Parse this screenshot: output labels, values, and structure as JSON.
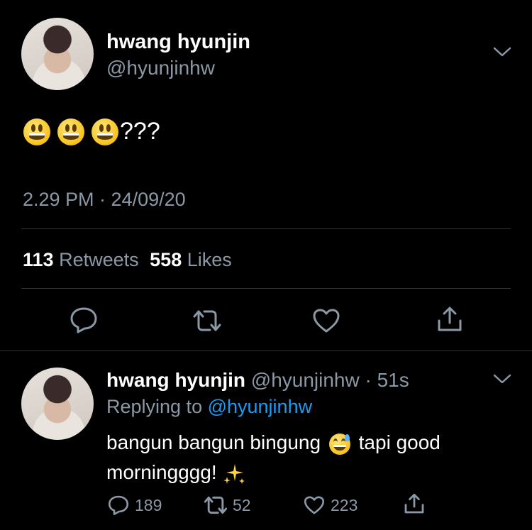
{
  "tweet": {
    "display_name": "hwang hyunjin",
    "handle": "@hyunjinhw",
    "emoji_count": 3,
    "text_suffix": "???",
    "timestamp": "2.29 PM · 24/09/20",
    "retweets_count": "113",
    "retweets_label": "Retweets",
    "likes_count": "558",
    "likes_label": "Likes"
  },
  "reply": {
    "display_name": "hwang hyunjin",
    "handle_time": "@hyunjinhw · 51s",
    "replying_prefix": "Replying to ",
    "replying_handle": "@hyunjinhw",
    "line1_a": "bangun bangun bingung ",
    "line1_b": " tapi good",
    "line2": "morningggg! ",
    "reply_count": "189",
    "retweet_count": "52",
    "like_count": "223"
  },
  "icons": {
    "menu": "chevron-down-icon",
    "reply": "speech-bubble-icon",
    "retweet": "retweet-arrows-icon",
    "like": "heart-icon",
    "share": "share-upload-icon",
    "emoji_main": "grinning-face",
    "emoji_reply": "grinning-sweat-face",
    "sparkles": "sparkles"
  },
  "colors": {
    "background": "#000000",
    "text": "#ffffff",
    "secondary": "#8b98a5",
    "link": "#1d9bf0",
    "divider": "#2f3336"
  }
}
